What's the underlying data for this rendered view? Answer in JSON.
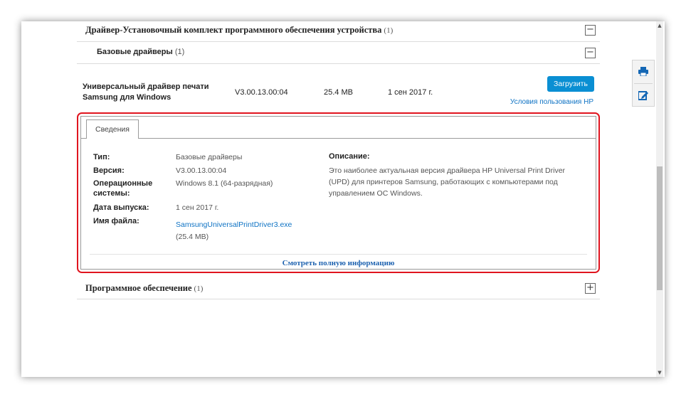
{
  "sections": {
    "driver_kit": {
      "title": "Драйвер-Установочный комплект программного обеспечения устройства",
      "count": "(1)",
      "toggle": "−"
    },
    "basic_drivers": {
      "title": "Базовые драйверы",
      "count": "(1)",
      "toggle": "−"
    },
    "software": {
      "title": "Программное обеспечение",
      "count": "(1)",
      "toggle": "+"
    }
  },
  "driver": {
    "name": "Универсальный драйвер печати Samsung для Windows",
    "version": "V3.00.13.00:04",
    "size": "25.4 MB",
    "date": "1 сен 2017 г.",
    "download_label": "Загрузить",
    "terms_link": "Условия пользования HP"
  },
  "details": {
    "tab_label": "Сведения",
    "type_label": "Тип:",
    "type_value": "Базовые драйверы",
    "version_label": "Версия:",
    "version_value": "V3.00.13.00:04",
    "os_label": "Операционные системы:",
    "os_value": "Windows 8.1 (64-разрядная)",
    "date_label": "Дата выпуска:",
    "date_value": "1 сен 2017 г.",
    "file_label": "Имя файла:",
    "file_value": "SamsungUniversalPrintDriver3.exe",
    "file_size": "(25.4 MB)",
    "description_label": "Описание:",
    "description_text": "Это наиболее актуальная версия драйвера HP Universal Print Driver (UPD) для принтеров Samsung, работающих с компьютерами под управлением ОС Windows.",
    "full_info_link": "Смотреть полную информацию"
  },
  "side_tools": [
    "printer-icon",
    "edit-icon"
  ],
  "colors": {
    "accent": "#0a8fd3",
    "link": "#0f73c4",
    "highlight": "#e0151f"
  }
}
